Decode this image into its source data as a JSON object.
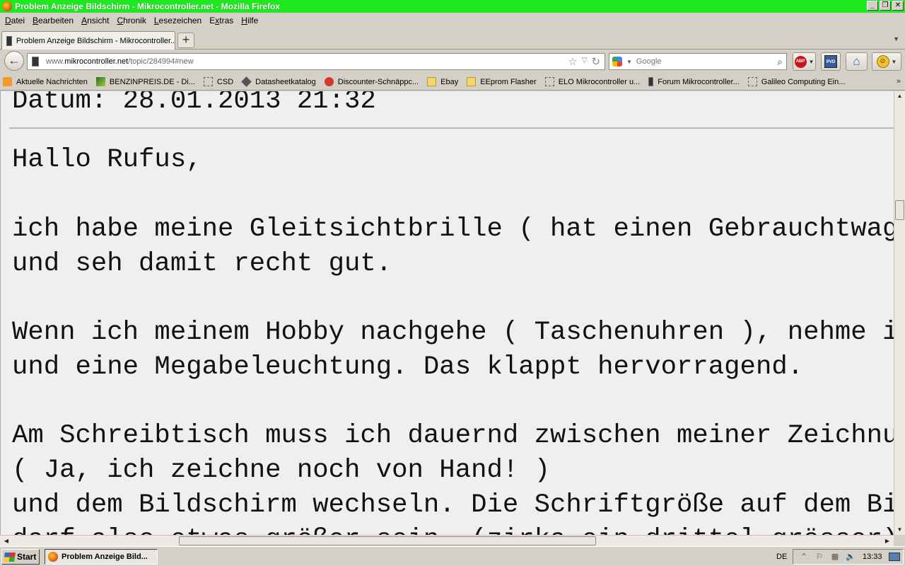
{
  "window": {
    "title": "Problem Anzeige Bildschirm - Mikrocontroller.net - Mozilla Firefox",
    "buttons": [
      "_",
      "❐",
      "✕"
    ]
  },
  "menu": {
    "items": [
      {
        "pre": "",
        "key": "D",
        "post": "atei"
      },
      {
        "pre": "",
        "key": "B",
        "post": "earbeiten"
      },
      {
        "pre": "",
        "key": "A",
        "post": "nsicht"
      },
      {
        "pre": "",
        "key": "C",
        "post": "hronik"
      },
      {
        "pre": "",
        "key": "L",
        "post": "esezeichen"
      },
      {
        "pre": "E",
        "key": "x",
        "post": "tras"
      },
      {
        "pre": "",
        "key": "H",
        "post": "ilfe"
      }
    ]
  },
  "tabs": {
    "active_label": "Problem Anzeige Bildschirm - Mikrocontroller....",
    "new_tab_label": "+",
    "list_arrow": "▼"
  },
  "nav": {
    "url_prefix": "www.",
    "url_domain": "mikrocontroller.net",
    "url_path": "/topic/284994#new",
    "search_placeholder": "Google",
    "abp_label": "ABP",
    "pvd_label": "PVD"
  },
  "bookmarks": [
    {
      "label": "Aktuelle Nachrichten",
      "icon": "rss-icon"
    },
    {
      "label": "BENZINPREIS.DE - Di...",
      "icon": "benzin-icon"
    },
    {
      "label": "CSD",
      "icon": "empty-page-icon"
    },
    {
      "label": "Datasheetkatalog",
      "icon": "chip-icon"
    },
    {
      "label": "Discounter-Schnäppc...",
      "icon": "discounter-icon"
    },
    {
      "label": "Ebay",
      "icon": "folder-icon"
    },
    {
      "label": "EEprom Flasher",
      "icon": "folder-icon"
    },
    {
      "label": "ELO Mikrocontroller u...",
      "icon": "empty-page-icon"
    },
    {
      "label": "Forum Mikrocontroller...",
      "icon": "mikrocontroller-icon"
    },
    {
      "label": "Galileo Computing Ein...",
      "icon": "empty-page-icon"
    }
  ],
  "post": {
    "date_line": "Datum: 28.01.2013 21:32",
    "lines": [
      "Hallo Rufus,",
      "",
      "ich habe meine Gleitsichtbrille ( hat einen Gebrauchtwag",
      "und seh damit recht gut.",
      "",
      "Wenn ich meinem Hobby nachgehe ( Taschenuhren ), nehme i",
      "und eine Megabeleuchtung. Das klappt hervorragend.",
      "",
      "Am Schreibtisch muss ich dauernd zwischen meiner Zeichnu",
      "( Ja, ich zeichne noch von Hand! )",
      "und dem Bildschirm wechseln. Die Schriftgröße auf dem Bi",
      "darf also etwas größer sein. (zirka ein drittel grösser)"
    ]
  },
  "taskbar": {
    "start_label": "Start",
    "task_label": "Problem Anzeige Bild...",
    "language": "DE",
    "clock": "13:33"
  }
}
